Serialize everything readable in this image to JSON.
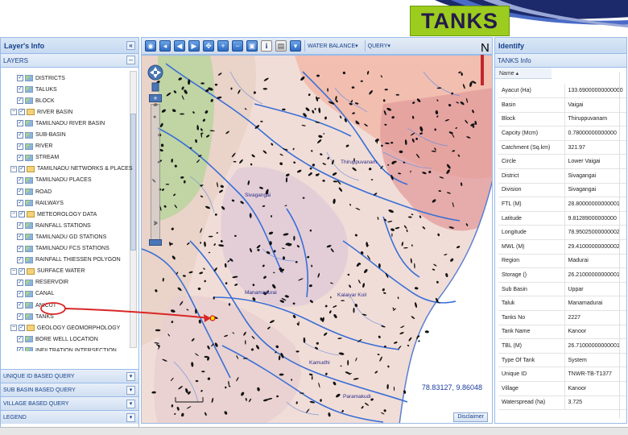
{
  "slide": {
    "title": "TANKS"
  },
  "left_panel": {
    "header": "Layer's Info",
    "layers_label": "LAYERS",
    "tree": [
      {
        "label": "DISTRICTS",
        "level": 2,
        "kind": "layer",
        "checked": true
      },
      {
        "label": "TALUKS",
        "level": 2,
        "kind": "layer",
        "checked": true
      },
      {
        "label": "BLOCK",
        "level": 2,
        "kind": "layer",
        "checked": true
      },
      {
        "label": "RIVER BASIN",
        "level": 1,
        "kind": "group",
        "checked": true
      },
      {
        "label": "TAMILNADU RIVER BASIN",
        "level": 2,
        "kind": "layer",
        "checked": true
      },
      {
        "label": "SUB-BASIN",
        "level": 2,
        "kind": "layer",
        "checked": true
      },
      {
        "label": "RIVER",
        "level": 2,
        "kind": "layer",
        "checked": true
      },
      {
        "label": "STREAM",
        "level": 2,
        "kind": "layer",
        "checked": true
      },
      {
        "label": "TAMILNADU NETWORKS & PLACES",
        "level": 1,
        "kind": "group",
        "checked": true
      },
      {
        "label": "TAMILNADU PLACES",
        "level": 2,
        "kind": "layer",
        "checked": true
      },
      {
        "label": "ROAD",
        "level": 2,
        "kind": "layer",
        "checked": true
      },
      {
        "label": "RAILWAYS",
        "level": 2,
        "kind": "layer",
        "checked": true
      },
      {
        "label": "METEOROLOGY DATA",
        "level": 1,
        "kind": "group",
        "checked": true
      },
      {
        "label": "RAINFALL STATIONS",
        "level": 2,
        "kind": "layer",
        "checked": true
      },
      {
        "label": "TAMILNADU GD STATIONS",
        "level": 2,
        "kind": "layer",
        "checked": true
      },
      {
        "label": "TAMILNADU FCS STATIONS",
        "level": 2,
        "kind": "layer",
        "checked": true
      },
      {
        "label": "RAINFALL THIESSEN POLYGON",
        "level": 2,
        "kind": "layer",
        "checked": true
      },
      {
        "label": "SURFACE WATER",
        "level": 1,
        "kind": "group",
        "checked": true
      },
      {
        "label": "RESERVOIR",
        "level": 2,
        "kind": "layer",
        "checked": true
      },
      {
        "label": "CANAL",
        "level": 2,
        "kind": "layer",
        "checked": true
      },
      {
        "label": "ANICUT",
        "level": 2,
        "kind": "layer",
        "checked": true
      },
      {
        "label": "TANKS",
        "level": 2,
        "kind": "layer",
        "checked": true
      },
      {
        "label": "GEOLOGY GEOMORPHOLOGY",
        "level": 1,
        "kind": "group",
        "checked": true
      },
      {
        "label": "BORE WELL LOCATION",
        "level": 2,
        "kind": "layer",
        "checked": true
      },
      {
        "label": "INFILTRATION INTERSECTION",
        "level": 2,
        "kind": "layer",
        "checked": true
      },
      {
        "label": "INFILTRATION",
        "level": 2,
        "kind": "layer",
        "checked": true
      }
    ],
    "accordion": [
      {
        "label": "UNIQUE ID BASED QUERY"
      },
      {
        "label": "SUB BASIN BASED QUERY"
      },
      {
        "label": "VILLAGE BASED QUERY"
      },
      {
        "label": "LEGEND"
      }
    ]
  },
  "toolbar": {
    "menus": [
      "WATER BALANCE",
      "QUERY"
    ]
  },
  "map": {
    "coordinates": "78.83127, 9.86048",
    "disclaimer_label": "Disclaimer",
    "north_label": "N",
    "place_labels": [
      "Thiruppuvanam",
      "Sivagangai",
      "Manamadurai",
      "Kalaiyar Koil",
      "Paramakudi",
      "Kamudhi"
    ]
  },
  "right_panel": {
    "header": "Identify",
    "sub_header": "TANKS Info",
    "column_header": "Name",
    "properties": [
      {
        "key": "Ayacut (Ha)",
        "value": "133.69000000000000"
      },
      {
        "key": "Basin",
        "value": "Vaigai"
      },
      {
        "key": "Block",
        "value": "Thiruppuvanam"
      },
      {
        "key": "Capcity (Mcm)",
        "value": "0.78000000000000"
      },
      {
        "key": "Catchment (Sq.km)",
        "value": "321.97"
      },
      {
        "key": "Circle",
        "value": "Lower Vaigai"
      },
      {
        "key": "District",
        "value": "Sivagangai"
      },
      {
        "key": "Division",
        "value": "Sivagangai"
      },
      {
        "key": "FTL (M)",
        "value": "28.80000000000001"
      },
      {
        "key": "Latitude",
        "value": "9.81289000000000"
      },
      {
        "key": "Longitude",
        "value": "78.95025000000002"
      },
      {
        "key": "MWL (M)",
        "value": "29.41000000000002"
      },
      {
        "key": "Region",
        "value": "Madurai"
      },
      {
        "key": "Storage ()",
        "value": "26.21000000000001"
      },
      {
        "key": "Sub Basin",
        "value": "Uppar"
      },
      {
        "key": "Taluk",
        "value": "Manamadurai"
      },
      {
        "key": "Tanks No",
        "value": "2227"
      },
      {
        "key": "Tank Name",
        "value": "Kanoor"
      },
      {
        "key": "TBL (M)",
        "value": "26.71000000000001"
      },
      {
        "key": "Type Of Tank",
        "value": "System"
      },
      {
        "key": "Unique ID",
        "value": "TNWR-TB-T1377"
      },
      {
        "key": "Village",
        "value": "Kanoor"
      },
      {
        "key": "Waterspread (ha)",
        "value": "3.725"
      }
    ]
  },
  "colors": {
    "title_bg": "#9ccc1e",
    "title_text": "#241a4c",
    "panel_border": "#99bbe8",
    "annotation": "#d92626",
    "river": "#3a6fd6",
    "tank_marks": "#111111"
  }
}
